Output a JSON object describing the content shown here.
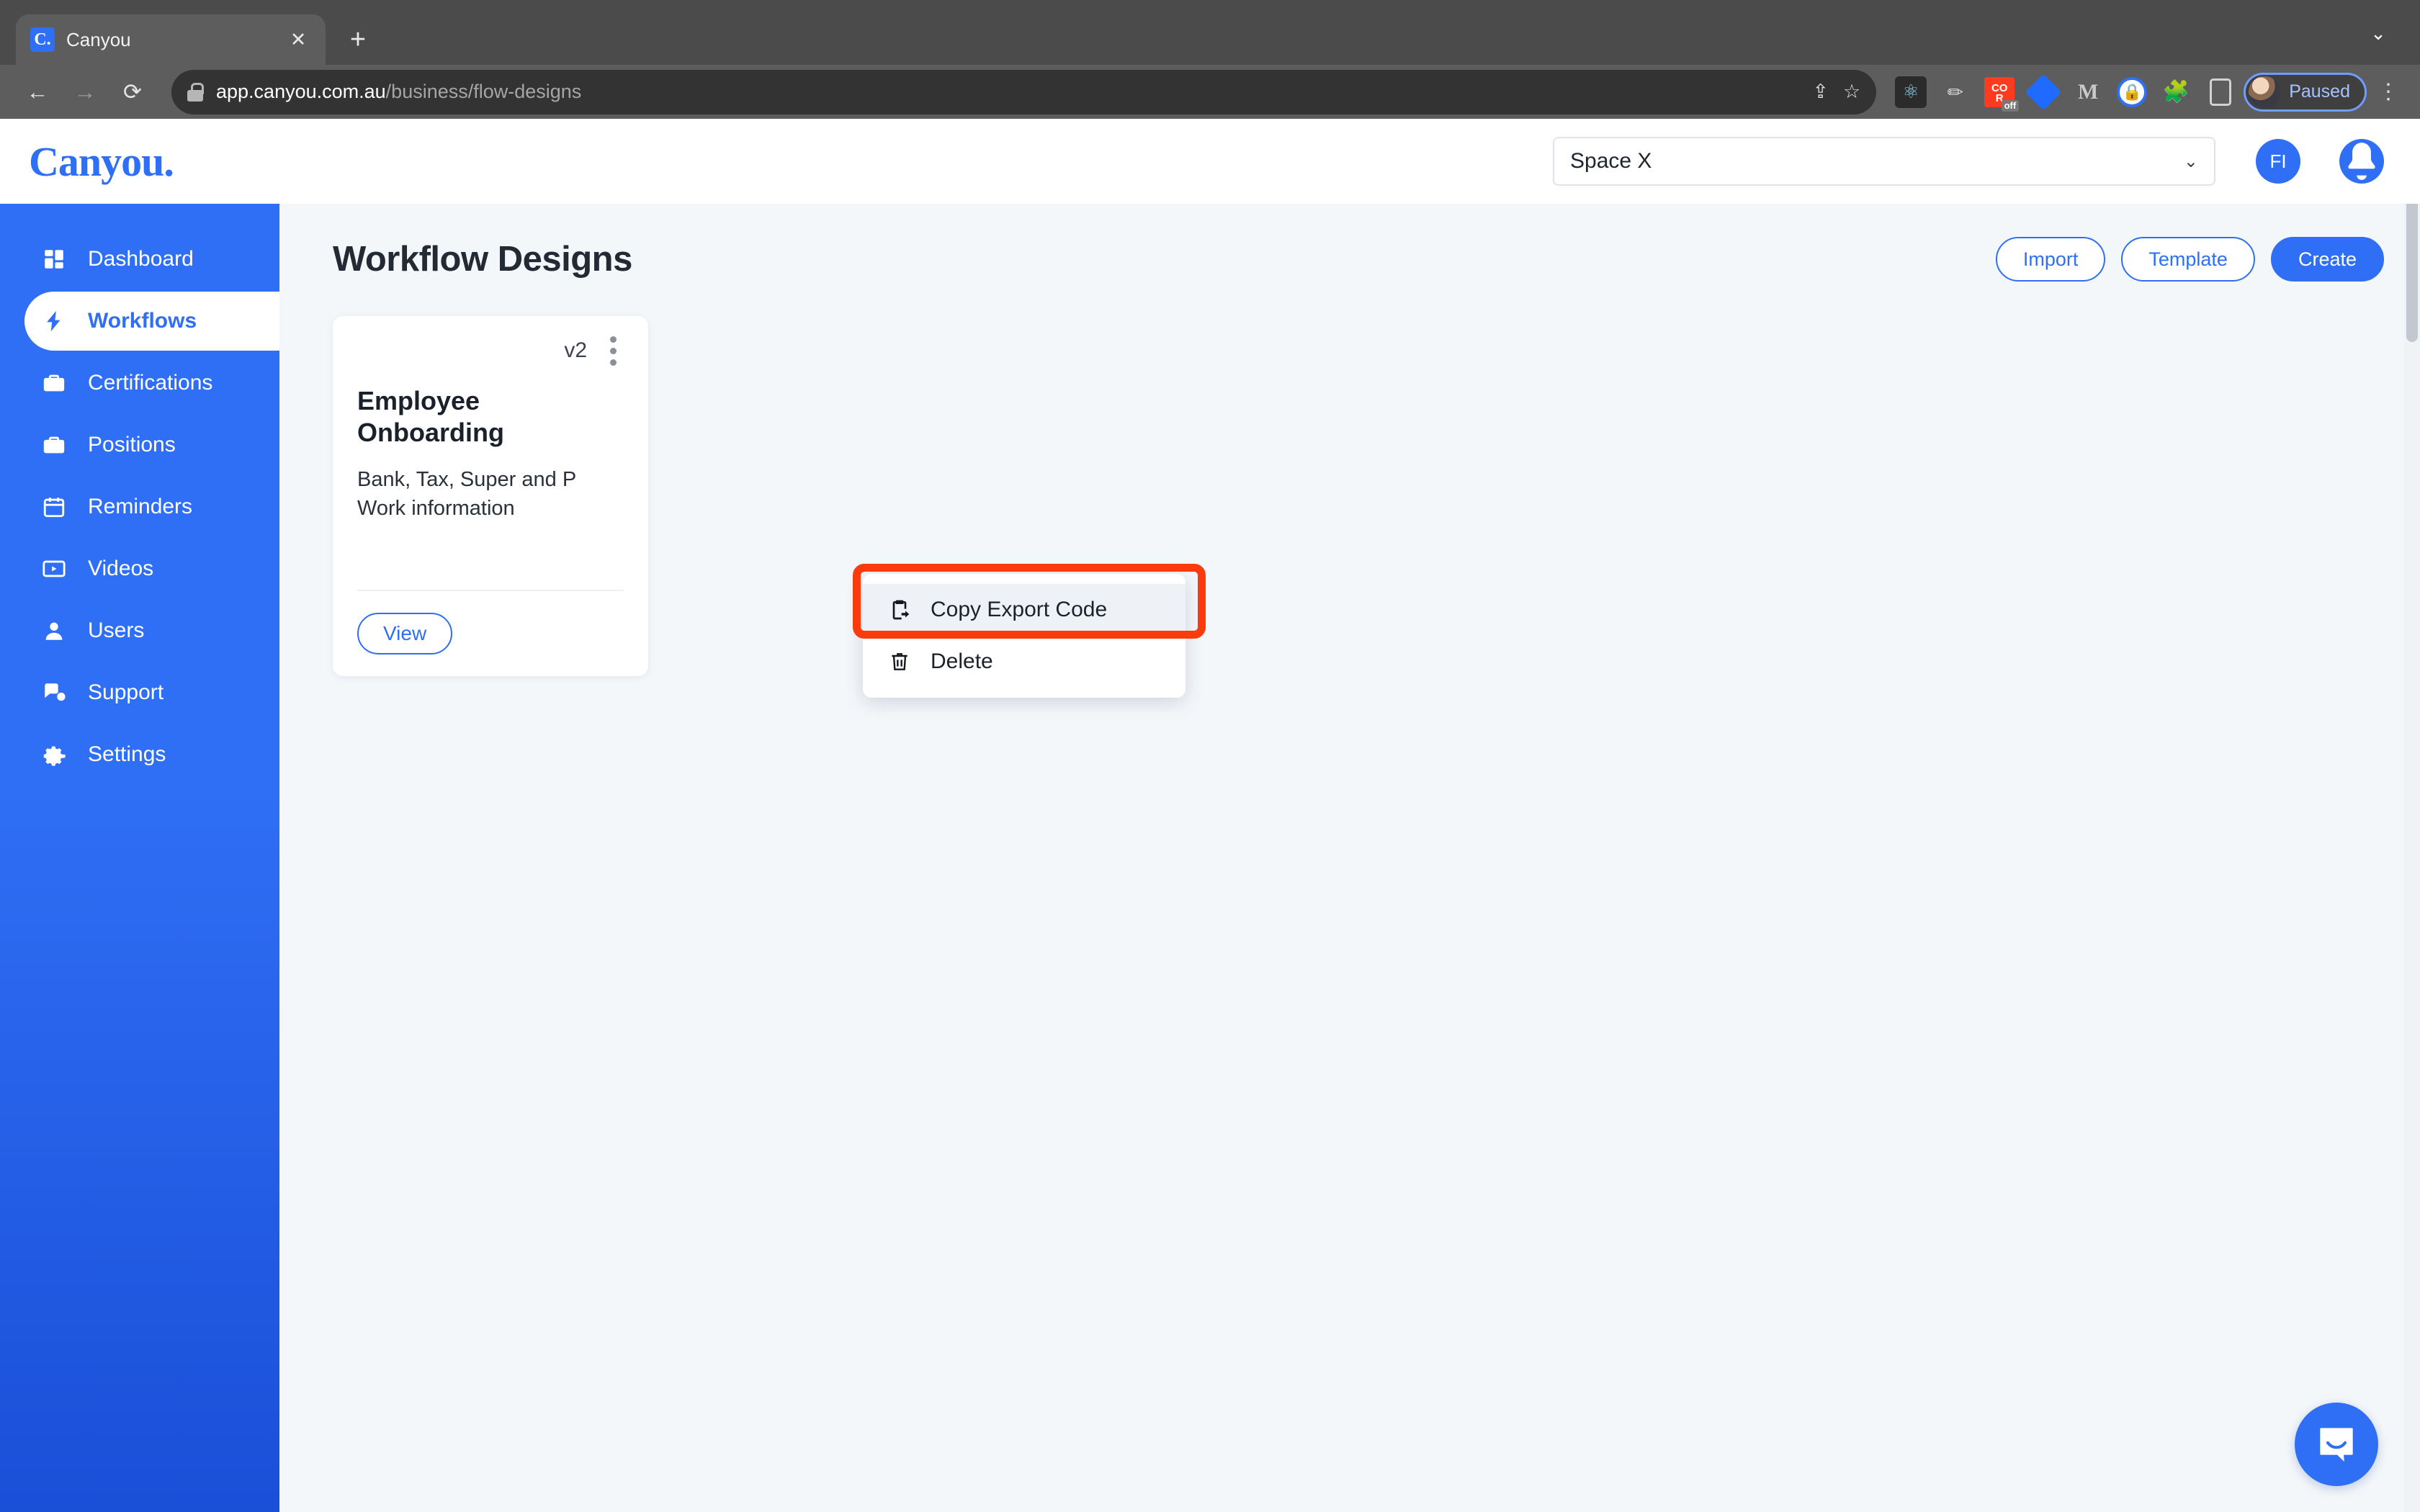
{
  "browser": {
    "tab": {
      "title": "Canyou",
      "favicon_letter": "C.",
      "close_icon": "✕"
    },
    "new_tab_icon": "+",
    "collapse_icon": "⌄",
    "back_icon": "←",
    "forward_icon": "→",
    "reload_icon": "⟳",
    "url_host": "app.canyou.com.au",
    "url_path": "/business/flow-designs",
    "share_icon": "⇪",
    "bookmark_icon": "☆",
    "extensions": [
      {
        "name": "react-devtools-icon",
        "glyph": "⚛"
      },
      {
        "name": "pen-tool-icon",
        "glyph": "✎"
      },
      {
        "name": "cors-toggle-icon",
        "glyph": "CO R",
        "badge": "off"
      },
      {
        "name": "diamond-extension-icon",
        "glyph": ""
      },
      {
        "name": "mail-extension-icon",
        "glyph": "M"
      },
      {
        "name": "password-manager-icon",
        "glyph": "🔒"
      },
      {
        "name": "extensions-puzzle-icon",
        "glyph": "🧩"
      },
      {
        "name": "side-panel-icon",
        "glyph": ""
      }
    ],
    "profile_label": "Paused",
    "browser_menu_icon": "⋮"
  },
  "header": {
    "logo": "Canyou.",
    "space_selector": {
      "value": "Space X",
      "chevron": "⌄"
    },
    "avatar_initials": "FI",
    "bell_icon": "🔔"
  },
  "sidebar": {
    "items": [
      {
        "label": "Dashboard",
        "icon": "grid-icon",
        "active": false
      },
      {
        "label": "Workflows",
        "icon": "lightning-icon",
        "active": true
      },
      {
        "label": "Certifications",
        "icon": "briefcase-icon",
        "active": false
      },
      {
        "label": "Positions",
        "icon": "briefcase-icon",
        "active": false
      },
      {
        "label": "Reminders",
        "icon": "calendar-icon",
        "active": false
      },
      {
        "label": "Videos",
        "icon": "video-icon",
        "active": false
      },
      {
        "label": "Users",
        "icon": "person-icon",
        "active": false
      },
      {
        "label": "Support",
        "icon": "chat-help-icon",
        "active": false
      },
      {
        "label": "Settings",
        "icon": "gear-icon",
        "active": false
      }
    ]
  },
  "main": {
    "page_title": "Workflow Designs",
    "actions": {
      "import": "Import",
      "template": "Template",
      "create": "Create"
    },
    "card": {
      "version": "v2",
      "title": "Employee Onboarding",
      "description": "Bank, Tax, Super and P Work information",
      "view_label": "View",
      "menu_icon": "⋮"
    },
    "context_menu": {
      "items": [
        {
          "label": "Copy Export Code",
          "icon": "clipboard-export-icon",
          "highlighted": true
        },
        {
          "label": "Delete",
          "icon": "trash-icon",
          "highlighted": false
        }
      ]
    },
    "chat_widget_icon": "intercom-chat-icon"
  },
  "colors": {
    "brand_blue": "#2f6ff5",
    "sidebar_gradient_end": "#1a4fd8",
    "annotation_red": "#fb3b0b",
    "page_background": "#f4f7fa",
    "title_dark": "#242a33"
  }
}
